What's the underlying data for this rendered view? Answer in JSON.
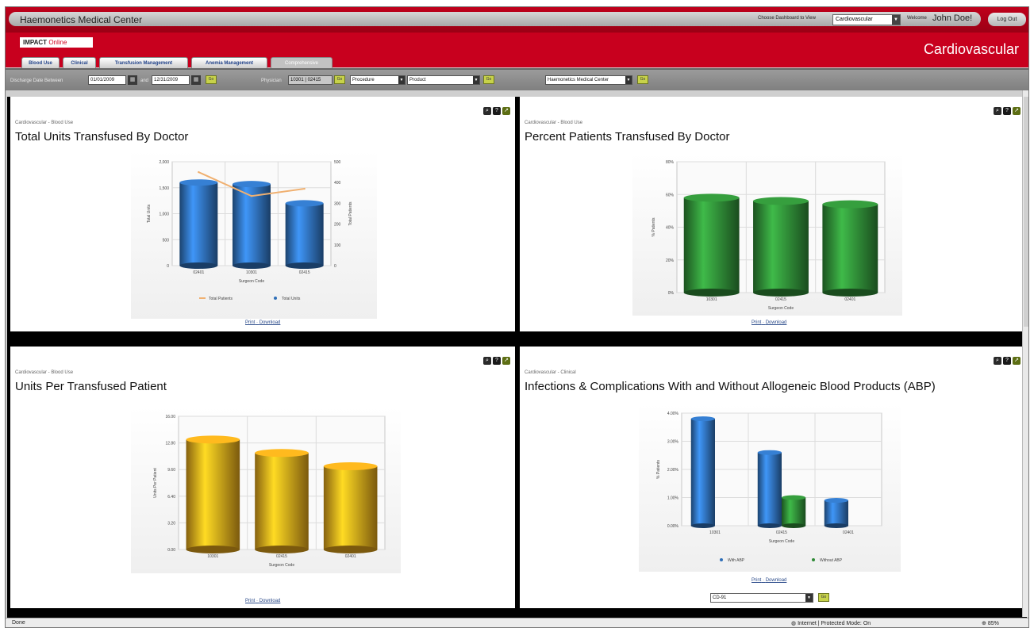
{
  "app": {
    "title": "Haemonetics Medical Center",
    "logo_text": "IMPACT",
    "logo_sub": "Online",
    "section_title": "Cardiovascular",
    "dashboard_label": "Choose Dashboard to View",
    "dashboard_value": "Cardiovascular",
    "welcome_label": "Welcome",
    "user_name": "John Doe!",
    "logout_label": "Log Out"
  },
  "tabs": [
    {
      "label": "Blood Use"
    },
    {
      "label": "Clinical"
    },
    {
      "label": "Transfusion Management"
    },
    {
      "label": "Anemia Management"
    },
    {
      "label": "Comprehensive"
    }
  ],
  "filters": {
    "discharge_label": "Discharge Date Between",
    "date_from": "01/01/2009",
    "and_label": "and",
    "date_to": "12/31/2009",
    "go_label": "Go",
    "physician_label": "Physician",
    "physician_value": "10301 | 02415",
    "procedure_value": "Procedure",
    "product_value": "Product",
    "facility_value": "Haemonetics Medical Center"
  },
  "panels": [
    {
      "crumb": "Cardiovascular - Blood Use",
      "title": "Total Units Transfused By Doctor",
      "print": "Print",
      "download": "Download",
      "legend": [
        "Total Patients",
        "Total Units"
      ]
    },
    {
      "crumb": "Cardiovascular - Blood Use",
      "title": "Percent Patients Transfused By Doctor",
      "print": "Print",
      "download": "Download"
    },
    {
      "crumb": "Cardiovascular - Blood Use",
      "title": "Units Per Transfused Patient",
      "print": "Print",
      "download": "Download"
    },
    {
      "crumb": "Cardiovascular - Clinical",
      "title": "Infections & Complications With and Without Allogeneic Blood Products (ABP)",
      "print": "Print",
      "download": "Download",
      "legend": [
        "With ABP",
        "Without ABP"
      ],
      "select_value": "CD-91",
      "go_label": "Go"
    }
  ],
  "chart_data": [
    {
      "type": "bar",
      "title": "Total Units Transfused By Doctor",
      "xlabel": "Surgeon Code",
      "ylabel": "Total Units",
      "y2label": "Total Patients",
      "categories": [
        "02401",
        "10301",
        "02415"
      ],
      "ylim": [
        0,
        2000
      ],
      "yticks": [
        "0",
        "500",
        "1,000",
        "1,500",
        "2,000"
      ],
      "y2lim": [
        0,
        500
      ],
      "y2ticks": [
        "0",
        "100",
        "200",
        "300",
        "400",
        "500"
      ],
      "series": [
        {
          "name": "Total Units",
          "type": "bar",
          "axis": "y",
          "values": [
            1600,
            1570,
            1200
          ],
          "color": "#2f6fb8"
        },
        {
          "name": "Total Patients",
          "type": "line",
          "axis": "y2",
          "values": [
            450,
            335,
            370
          ],
          "color": "#f0b070"
        }
      ]
    },
    {
      "type": "bar",
      "title": "Percent Patients Transfused By Doctor",
      "xlabel": "Surgeon Code",
      "ylabel": "% Patients",
      "categories": [
        "10301",
        "02415",
        "02401"
      ],
      "ylim": [
        0,
        80
      ],
      "yticks": [
        "0%",
        "20%",
        "40%",
        "60%",
        "80%"
      ],
      "series": [
        {
          "name": "",
          "values": [
            58,
            56,
            54
          ],
          "color": "#2f8a36"
        }
      ]
    },
    {
      "type": "bar",
      "title": "Units Per Transfused Patient",
      "xlabel": "Surgeon Code",
      "ylabel": "Units Per Patient",
      "categories": [
        "10301",
        "02415",
        "02401"
      ],
      "ylim": [
        0,
        16
      ],
      "yticks": [
        "0.00",
        "3.20",
        "6.40",
        "9.60",
        "12.80",
        "16.00"
      ],
      "series": [
        {
          "name": "",
          "values": [
            13.2,
            11.6,
            10.0
          ],
          "color": "#e0a21a"
        }
      ]
    },
    {
      "type": "bar",
      "title": "Infections & Complications With and Without Allogeneic Blood Products (ABP)",
      "xlabel": "Surgeon Code",
      "ylabel": "% Patients",
      "categories": [
        "10301",
        "02415",
        "02401"
      ],
      "ylim": [
        0,
        4
      ],
      "yticks": [
        "0.00%",
        "1.00%",
        "2.00%",
        "3.00%",
        "4.00%"
      ],
      "series": [
        {
          "name": "With ABP",
          "values": [
            3.8,
            2.6,
            0.9
          ],
          "color": "#2f6fb8"
        },
        {
          "name": "Without ABP",
          "values": [
            0,
            1.0,
            0
          ],
          "color": "#2f8a36"
        }
      ]
    }
  ],
  "status": {
    "left": "Done",
    "zone": "Internet | Protected Mode: On",
    "zoom": "85%"
  }
}
